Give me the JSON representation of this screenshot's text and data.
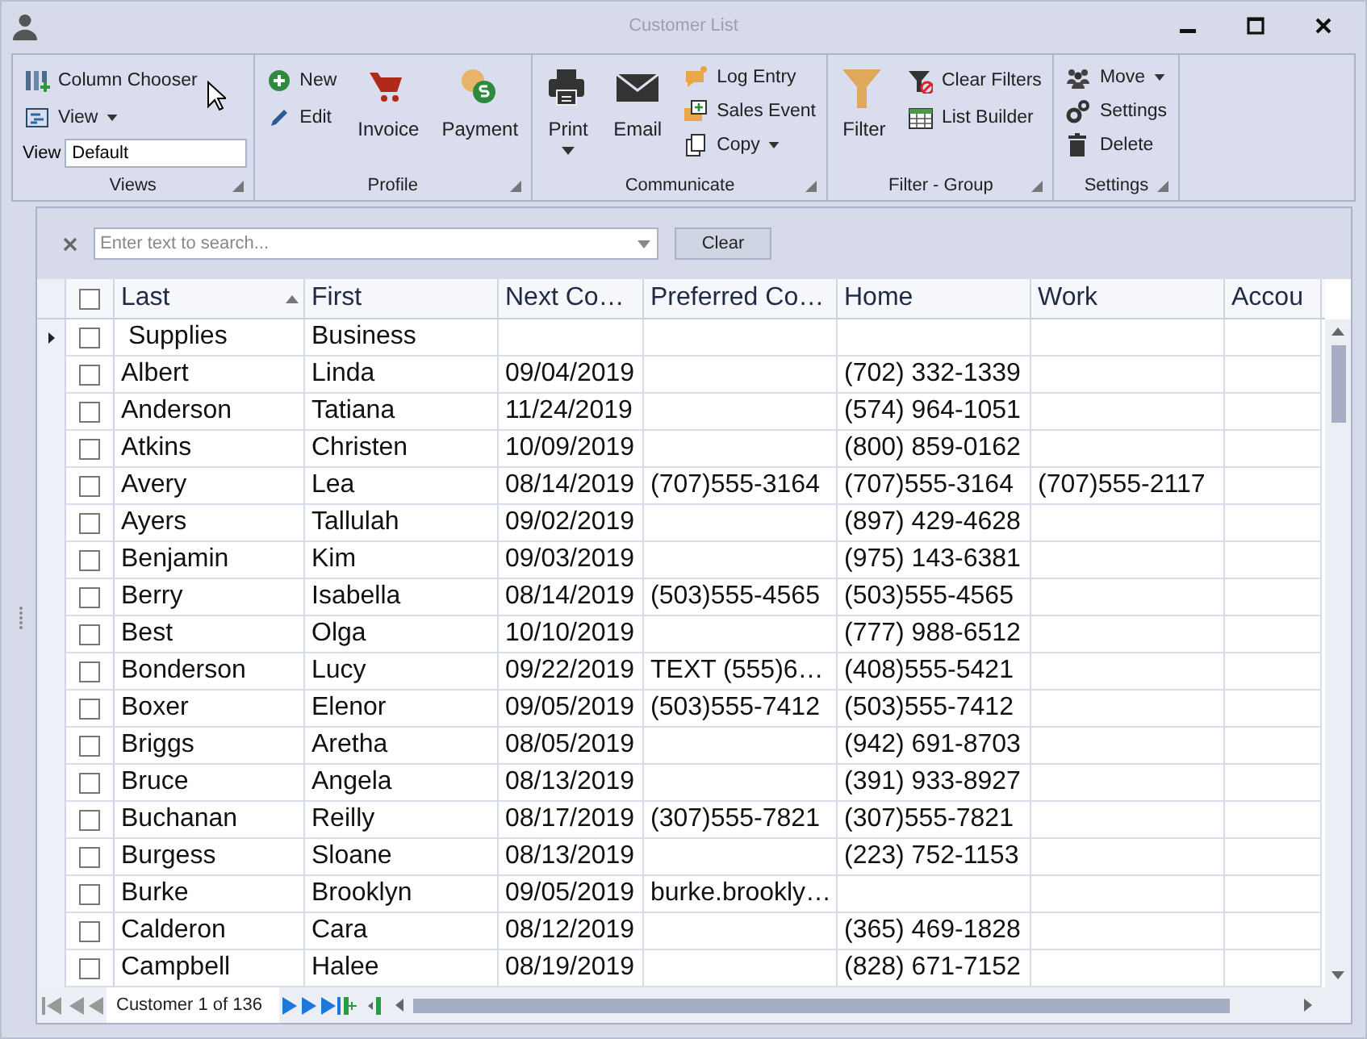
{
  "window": {
    "title": "Customer List"
  },
  "ribbon": {
    "groups": [
      {
        "label": "Views",
        "columns": [
          {
            "kind": "stack",
            "items": [
              {
                "label": "Column Chooser",
                "dropdown": false
              },
              {
                "label": "View",
                "dropdown": true
              }
            ]
          }
        ],
        "field": {
          "label": "View",
          "value": "Default"
        }
      },
      {
        "label": "Profile",
        "columns": [
          {
            "kind": "stack",
            "items": [
              {
                "label": "New",
                "dropdown": false
              },
              {
                "label": "Edit",
                "dropdown": false
              }
            ]
          },
          {
            "kind": "large",
            "items": [
              {
                "label": "Invoice",
                "dropdown": false
              }
            ]
          },
          {
            "kind": "large",
            "items": [
              {
                "label": "Payment",
                "dropdown": false
              }
            ]
          }
        ]
      },
      {
        "label": "Communicate",
        "columns": [
          {
            "kind": "large",
            "items": [
              {
                "label": "Print",
                "dropdown": true
              }
            ]
          },
          {
            "kind": "large",
            "items": [
              {
                "label": "Email",
                "dropdown": false
              }
            ]
          },
          {
            "kind": "stack",
            "items": [
              {
                "label": "Log Entry",
                "dropdown": false
              },
              {
                "label": "Sales Event",
                "dropdown": false
              },
              {
                "label": "Copy",
                "dropdown": true
              }
            ]
          }
        ]
      },
      {
        "label": "Filter - Group",
        "columns": [
          {
            "kind": "large",
            "items": [
              {
                "label": "Filter",
                "dropdown": false
              }
            ]
          },
          {
            "kind": "stack",
            "items": [
              {
                "label": "Clear Filters",
                "dropdown": false
              },
              {
                "label": "List Builder",
                "dropdown": false
              }
            ]
          }
        ]
      },
      {
        "label": "Settings",
        "columns": [
          {
            "kind": "stack",
            "items": [
              {
                "label": "Move",
                "dropdown": true
              },
              {
                "label": "Settings",
                "dropdown": false
              },
              {
                "label": "Delete",
                "dropdown": false
              }
            ]
          }
        ]
      }
    ]
  },
  "search": {
    "placeholder": "Enter text to search...",
    "clear_label": "Clear"
  },
  "table": {
    "header_checked": false,
    "columns": [
      {
        "label": "Last",
        "sorted": true
      },
      {
        "label": "First",
        "sorted": false
      },
      {
        "label": "Next Co…",
        "sorted": false
      },
      {
        "label": "Preferred Co…",
        "sorted": false
      },
      {
        "label": "Home",
        "sorted": false
      },
      {
        "label": "Work",
        "sorted": false
      },
      {
        "label": "Accou",
        "sorted": false
      }
    ],
    "rows": [
      {
        "current": true,
        "checked": false,
        "cells": [
          " Supplies",
          "Business",
          null,
          null,
          null,
          null
        ]
      },
      {
        "current": false,
        "checked": false,
        "cells": [
          "Albert",
          "Linda",
          "09/04/2019",
          null,
          "(702) 332-1339",
          null
        ]
      },
      {
        "current": false,
        "checked": false,
        "cells": [
          "Anderson",
          "Tatiana",
          "11/24/2019",
          null,
          "(574) 964-1051",
          null
        ]
      },
      {
        "current": false,
        "checked": false,
        "cells": [
          "Atkins",
          "Christen",
          "10/09/2019",
          null,
          "(800) 859-0162",
          null
        ]
      },
      {
        "current": false,
        "checked": false,
        "cells": [
          "Avery",
          "Lea",
          "08/14/2019",
          "(707)555-3164",
          "(707)555-3164",
          "(707)555-2117"
        ]
      },
      {
        "current": false,
        "checked": false,
        "cells": [
          "Ayers",
          "Tallulah",
          "09/02/2019",
          null,
          "(897) 429-4628",
          null
        ]
      },
      {
        "current": false,
        "checked": false,
        "cells": [
          "Benjamin",
          "Kim",
          "09/03/2019",
          null,
          "(975) 143-6381",
          null
        ]
      },
      {
        "current": false,
        "checked": false,
        "cells": [
          "Berry",
          "Isabella",
          "08/14/2019",
          "(503)555-4565",
          "(503)555-4565",
          null
        ]
      },
      {
        "current": false,
        "checked": false,
        "cells": [
          "Best",
          "Olga",
          "10/10/2019",
          null,
          "(777) 988-6512",
          null
        ]
      },
      {
        "current": false,
        "checked": false,
        "cells": [
          "Bonderson",
          "Lucy",
          "09/22/2019",
          "TEXT (555)6…",
          "(408)555-5421",
          null
        ]
      },
      {
        "current": false,
        "checked": false,
        "cells": [
          "Boxer",
          "Elenor",
          "09/05/2019",
          "(503)555-7412",
          "(503)555-7412",
          null
        ]
      },
      {
        "current": false,
        "checked": false,
        "cells": [
          "Briggs",
          "Aretha",
          "08/05/2019",
          null,
          "(942) 691-8703",
          null
        ]
      },
      {
        "current": false,
        "checked": false,
        "cells": [
          "Bruce",
          "Angela",
          "08/13/2019",
          null,
          "(391) 933-8927",
          null
        ]
      },
      {
        "current": false,
        "checked": false,
        "cells": [
          "Buchanan",
          "Reilly",
          "08/17/2019",
          "(307)555-7821",
          "(307)555-7821",
          null
        ]
      },
      {
        "current": false,
        "checked": false,
        "cells": [
          "Burgess",
          "Sloane",
          "08/13/2019",
          null,
          "(223) 752-1153",
          null
        ]
      },
      {
        "current": false,
        "checked": false,
        "cells": [
          "Burke",
          "Brooklyn",
          "09/05/2019",
          "burke.brookly…",
          null,
          null
        ]
      },
      {
        "current": false,
        "checked": false,
        "cells": [
          "Calderon",
          "Cara",
          "08/12/2019",
          null,
          "(365) 469-1828",
          null
        ]
      },
      {
        "current": false,
        "checked": false,
        "cells": [
          "Campbell",
          "Halee",
          "08/19/2019",
          null,
          "(828) 671-7152",
          null
        ]
      }
    ]
  },
  "navigator": {
    "text": "Customer 1 of 136"
  }
}
